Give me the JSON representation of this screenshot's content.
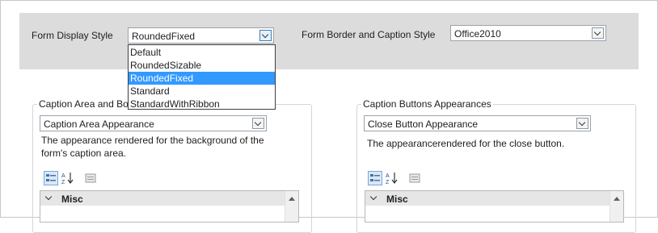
{
  "top": {
    "display_style_label": "Form Display Style",
    "display_style_value": "RoundedFixed",
    "border_caption_label": "Form Border and Caption Style",
    "border_caption_value": "Office2010"
  },
  "dropdown": {
    "options": [
      "Default",
      "RoundedSizable",
      "RoundedFixed",
      "Standard",
      "StandardWithRibbon"
    ],
    "selected_index": 2
  },
  "caption_area": {
    "legend": "Caption Area and Bo",
    "combo_value": "Caption Area Appearance",
    "description_line1": "The appearance rendered for the background of the",
    "description_line2": "form's caption area.",
    "category": "Misc"
  },
  "caption_buttons": {
    "legend": "Caption Buttons Appearances",
    "combo_value": "Close Button Appearance",
    "description": "The appearancerendered for the close button.",
    "category": "Misc"
  },
  "colors": {
    "panel_bg": "#dcdcdc",
    "selection": "#3399ff"
  }
}
